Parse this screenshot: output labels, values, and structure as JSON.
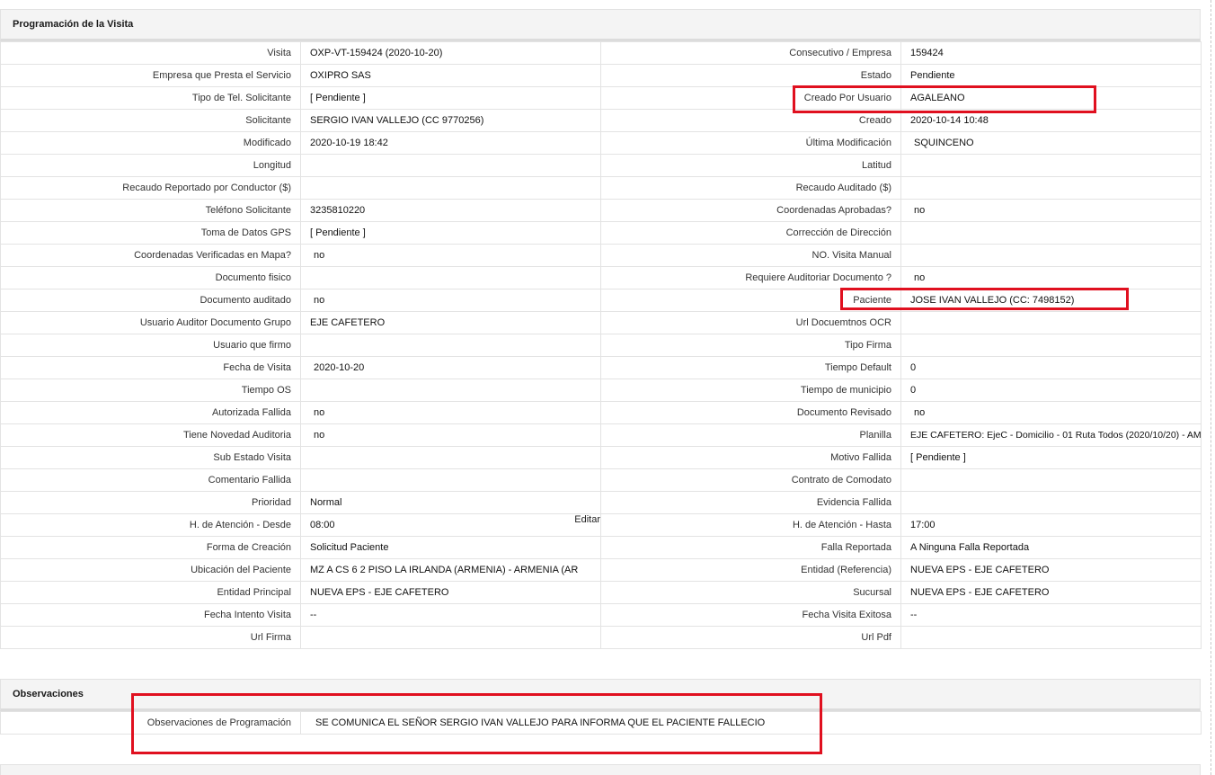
{
  "section_programacion": {
    "title": "Programación de la Visita",
    "rows": [
      {
        "l1": "Visita",
        "v1": "OXP-VT-159424 (2020-10-20)",
        "l2": "Consecutivo / Empresa",
        "v2": "159424"
      },
      {
        "l1": "Empresa que Presta el Servicio",
        "v1": "OXIPRO SAS",
        "l2": "Estado",
        "v2": "Pendiente"
      },
      {
        "l1": "Tipo de Tel. Solicitante",
        "v1": "[ Pendiente ]",
        "l2": "Creado Por Usuario",
        "v2": "AGALEANO"
      },
      {
        "l1": "Solicitante",
        "v1": "SERGIO IVAN VALLEJO (CC 9770256)",
        "l2": "Creado",
        "v2": "2020-10-14 10:48"
      },
      {
        "l1": "Modificado",
        "v1": "2020-10-19 18:42",
        "l2": "Última Modificación",
        "v2": "SQUINCENO"
      },
      {
        "l1": "Longitud",
        "v1": "",
        "l2": "Latitud",
        "v2": ""
      },
      {
        "l1": "Recaudo Reportado por Conductor ($)",
        "v1": "",
        "l2": "Recaudo Auditado ($)",
        "v2": ""
      },
      {
        "l1": "Teléfono Solicitante",
        "v1": "3235810220",
        "l2": "Coordenadas Aprobadas?",
        "v2": "no"
      },
      {
        "l1": "Toma de Datos GPS",
        "v1": "[ Pendiente ]",
        "l2": "Corrección de Dirección",
        "v2": ""
      },
      {
        "l1": "Coordenadas Verificadas en Mapa?",
        "v1": "no",
        "l2": "NO. Visita Manual",
        "v2": ""
      },
      {
        "l1": "Documento fisico",
        "v1": "",
        "l2": "Requiere Auditoriar Documento ?",
        "v2": "no"
      },
      {
        "l1": "Documento auditado",
        "v1": "no",
        "l2": "Paciente",
        "v2": "JOSE IVAN VALLEJO (CC: 7498152)"
      },
      {
        "l1": "Usuario Auditor Documento Grupo",
        "v1": "EJE CAFETERO",
        "l2": "Url Docuemtnos OCR",
        "v2": ""
      },
      {
        "l1": "Usuario que firmo",
        "v1": "",
        "l2": "Tipo Firma",
        "v2": ""
      },
      {
        "l1": "Fecha de Visita",
        "v1": "2020-10-20",
        "l2": "Tiempo Default",
        "v2": "0"
      },
      {
        "l1": "Tiempo OS",
        "v1": "",
        "l2": "Tiempo de municipio",
        "v2": "0"
      },
      {
        "l1": "Autorizada Fallida",
        "v1": "no",
        "l2": "Documento Revisado",
        "v2": "no"
      },
      {
        "l1": "Tiene Novedad Auditoria",
        "v1": "no",
        "l2": "Planilla",
        "v2": "EJE CAFETERO: EjeC - Domicilio - 01 Ruta Todos (2020/10/20) - AM"
      },
      {
        "l1": "Sub Estado Visita",
        "v1": "",
        "l2": "Motivo Fallida",
        "v2": "[ Pendiente ]"
      },
      {
        "l1": "Comentario Fallida",
        "v1": "",
        "l2": "Contrato de Comodato",
        "v2": ""
      },
      {
        "l1": "Prioridad",
        "v1": "Normal",
        "l2": "Evidencia Fallida",
        "v2": ""
      },
      {
        "l1": "H. de Atención - Desde",
        "v1": "08:00",
        "l2": "H. de Atención - Hasta",
        "v2": "17:00"
      },
      {
        "l1": "Forma de Creación",
        "v1": "Solicitud Paciente",
        "l2": "Falla Reportada",
        "v2": "A Ninguna Falla Reportada"
      },
      {
        "l1": "Ubicación del Paciente",
        "v1": "MZ A CS 6 2 PISO LA IRLANDA (ARMENIA) - ARMENIA (AR",
        "l2": "Entidad (Referencia)",
        "v2": "NUEVA EPS - EJE CAFETERO"
      },
      {
        "l1": "Entidad Principal",
        "v1": "NUEVA EPS - EJE CAFETERO",
        "l2": "Sucursal",
        "v2": "NUEVA EPS - EJE CAFETERO"
      },
      {
        "l1": "Fecha Intento Visita",
        "v1": "--",
        "l2": "Fecha Visita Exitosa",
        "v2": "--"
      },
      {
        "l1": "Url Firma",
        "v1": "",
        "l2": "Url Pdf",
        "v2": ""
      }
    ],
    "editar_label": "Editar"
  },
  "section_observaciones": {
    "title": "Observaciones",
    "label": "Observaciones de Programación",
    "value": "SE COMUNICA EL SEÑOR SERGIO IVAN VALLEJO PARA INFORMA QUE EL PACIENTE FALLECIO"
  },
  "highlight_color": "#e0101f"
}
